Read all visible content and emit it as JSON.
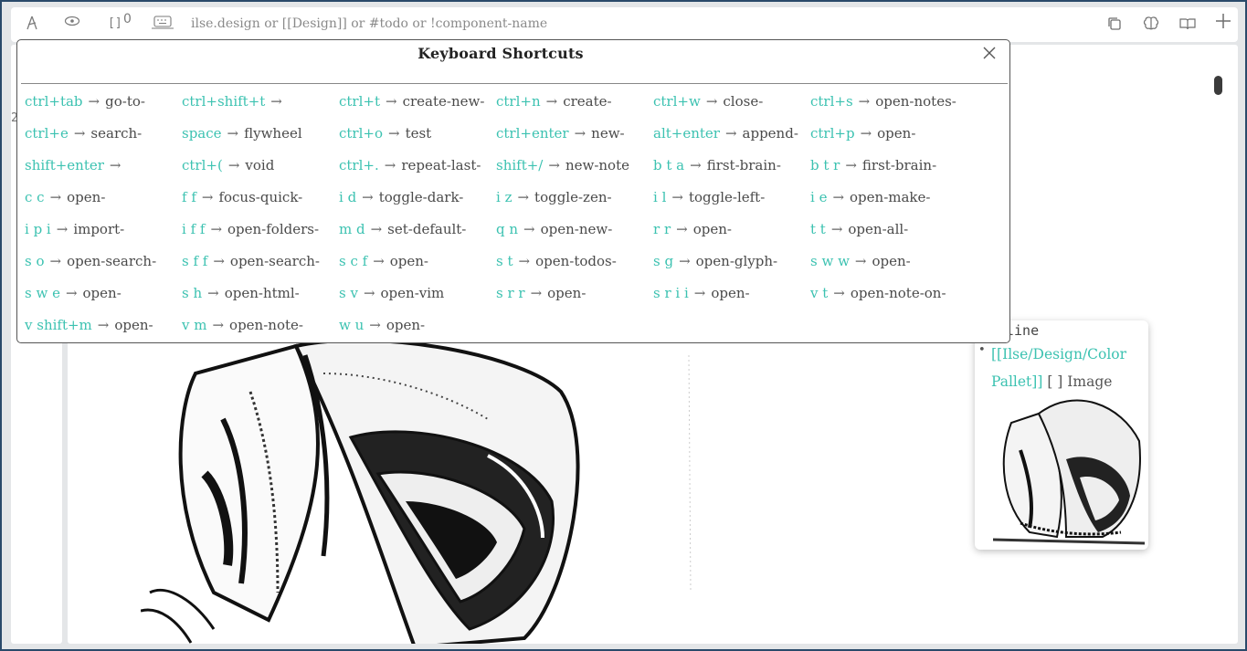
{
  "toolbar": {
    "count": "0",
    "search_placeholder": "ilse.design or [[Design]] or #todo or !component-name"
  },
  "gutter": {
    "line_number": "2"
  },
  "modal": {
    "title": "Keyboard Shortcuts",
    "arrow": "→",
    "shortcuts": [
      {
        "key": "ctrl+tab",
        "action": "go-to-"
      },
      {
        "key": "ctrl+shift+t",
        "action": ""
      },
      {
        "key": "ctrl+t",
        "action": "create-new-"
      },
      {
        "key": "ctrl+n",
        "action": "create-"
      },
      {
        "key": "ctrl+w",
        "action": "close-"
      },
      {
        "key": "ctrl+s",
        "action": "open-notes-"
      },
      {
        "key": "ctrl+e",
        "action": "search-"
      },
      {
        "key": "space",
        "action": "flywheel"
      },
      {
        "key": "ctrl+o",
        "action": "test"
      },
      {
        "key": "ctrl+enter",
        "action": "new-"
      },
      {
        "key": "alt+enter",
        "action": "append-"
      },
      {
        "key": "ctrl+p",
        "action": "open-"
      },
      {
        "key": "shift+enter",
        "action": ""
      },
      {
        "key": "ctrl+(",
        "action": "void"
      },
      {
        "key": "ctrl+.",
        "action": "repeat-last-"
      },
      {
        "key": "shift+/",
        "action": "new-note"
      },
      {
        "key": "b t a",
        "action": "first-brain-"
      },
      {
        "key": "b t r",
        "action": "first-brain-"
      },
      {
        "key": "c c",
        "action": "open-"
      },
      {
        "key": "f f",
        "action": "focus-quick-"
      },
      {
        "key": "i d",
        "action": "toggle-dark-"
      },
      {
        "key": "i z",
        "action": "toggle-zen-"
      },
      {
        "key": "i l",
        "action": "toggle-left-"
      },
      {
        "key": "i e",
        "action": "open-make-"
      },
      {
        "key": "i p i",
        "action": "import-"
      },
      {
        "key": "i f f",
        "action": "open-folders-"
      },
      {
        "key": "m d",
        "action": "set-default-"
      },
      {
        "key": "q n",
        "action": "open-new-"
      },
      {
        "key": "r r",
        "action": "open-"
      },
      {
        "key": "t t",
        "action": "open-all-"
      },
      {
        "key": "s o",
        "action": "open-search-"
      },
      {
        "key": "s f f",
        "action": "open-search-"
      },
      {
        "key": "s c f",
        "action": "open-"
      },
      {
        "key": "s t",
        "action": "open-todos-"
      },
      {
        "key": "s g",
        "action": "open-glyph-"
      },
      {
        "key": "s w w",
        "action": "open-"
      },
      {
        "key": "s w e",
        "action": "open-"
      },
      {
        "key": "s h",
        "action": "open-html-"
      },
      {
        "key": "s v",
        "action": "open-vim"
      },
      {
        "key": "s r r",
        "action": "open-"
      },
      {
        "key": "s r i i",
        "action": "open-"
      },
      {
        "key": "v t",
        "action": "open-note-on-"
      },
      {
        "key": "v shift+m",
        "action": "open-"
      },
      {
        "key": "v m",
        "action": "open-note-"
      },
      {
        "key": "w u",
        "action": "open-"
      }
    ]
  },
  "preview": {
    "title": "line",
    "bullet": "•",
    "link": "[[Ilse/Design/Color Pallet]]",
    "rest": "[ ] Image"
  }
}
